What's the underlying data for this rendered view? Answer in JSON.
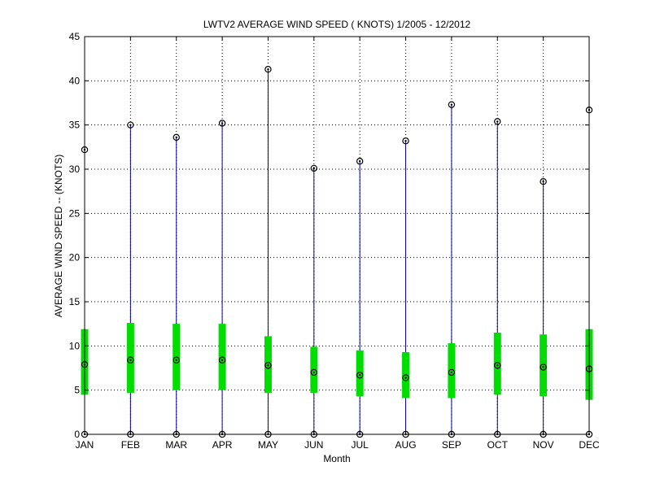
{
  "chart_data": {
    "type": "box",
    "title": "LWTV2  AVERAGE WIND SPEED ( KNOTS) 1/2005 - 12/2012",
    "xlabel": "Month",
    "ylabel": "AVERAGE WIND SPEED -- (KNOTS)",
    "categories": [
      "JAN",
      "FEB",
      "MAR",
      "APR",
      "MAY",
      "JUN",
      "JUL",
      "AUG",
      "SEP",
      "OCT",
      "NOV",
      "DEC"
    ],
    "ylim": [
      0,
      45
    ],
    "yticks": [
      0,
      5,
      10,
      15,
      20,
      25,
      30,
      35,
      40,
      45
    ],
    "grid": true,
    "series": [
      {
        "min": [
          0,
          0,
          0,
          0,
          0,
          0,
          0,
          0,
          0,
          0,
          0,
          0
        ]
      },
      {
        "q1": [
          4.5,
          4.7,
          5.0,
          5.0,
          4.7,
          4.7,
          4.3,
          4.1,
          4.1,
          4.5,
          4.3,
          3.9
        ]
      },
      {
        "mean": [
          7.9,
          8.4,
          8.4,
          8.4,
          7.8,
          7.0,
          6.7,
          6.4,
          7.0,
          7.8,
          7.6,
          7.4
        ]
      },
      {
        "q3": [
          11.9,
          12.6,
          12.5,
          12.5,
          11.1,
          9.9,
          9.5,
          9.3,
          10.3,
          11.5,
          11.3,
          11.9
        ]
      },
      {
        "max": [
          32.2,
          35.0,
          33.6,
          35.2,
          41.3,
          30.1,
          30.9,
          33.2,
          37.3,
          35.4,
          28.6,
          36.7
        ]
      }
    ],
    "colors": {
      "whisker": "#0000a0",
      "box": "#00dd00",
      "marker": "#000000",
      "grid": "#000000"
    }
  }
}
